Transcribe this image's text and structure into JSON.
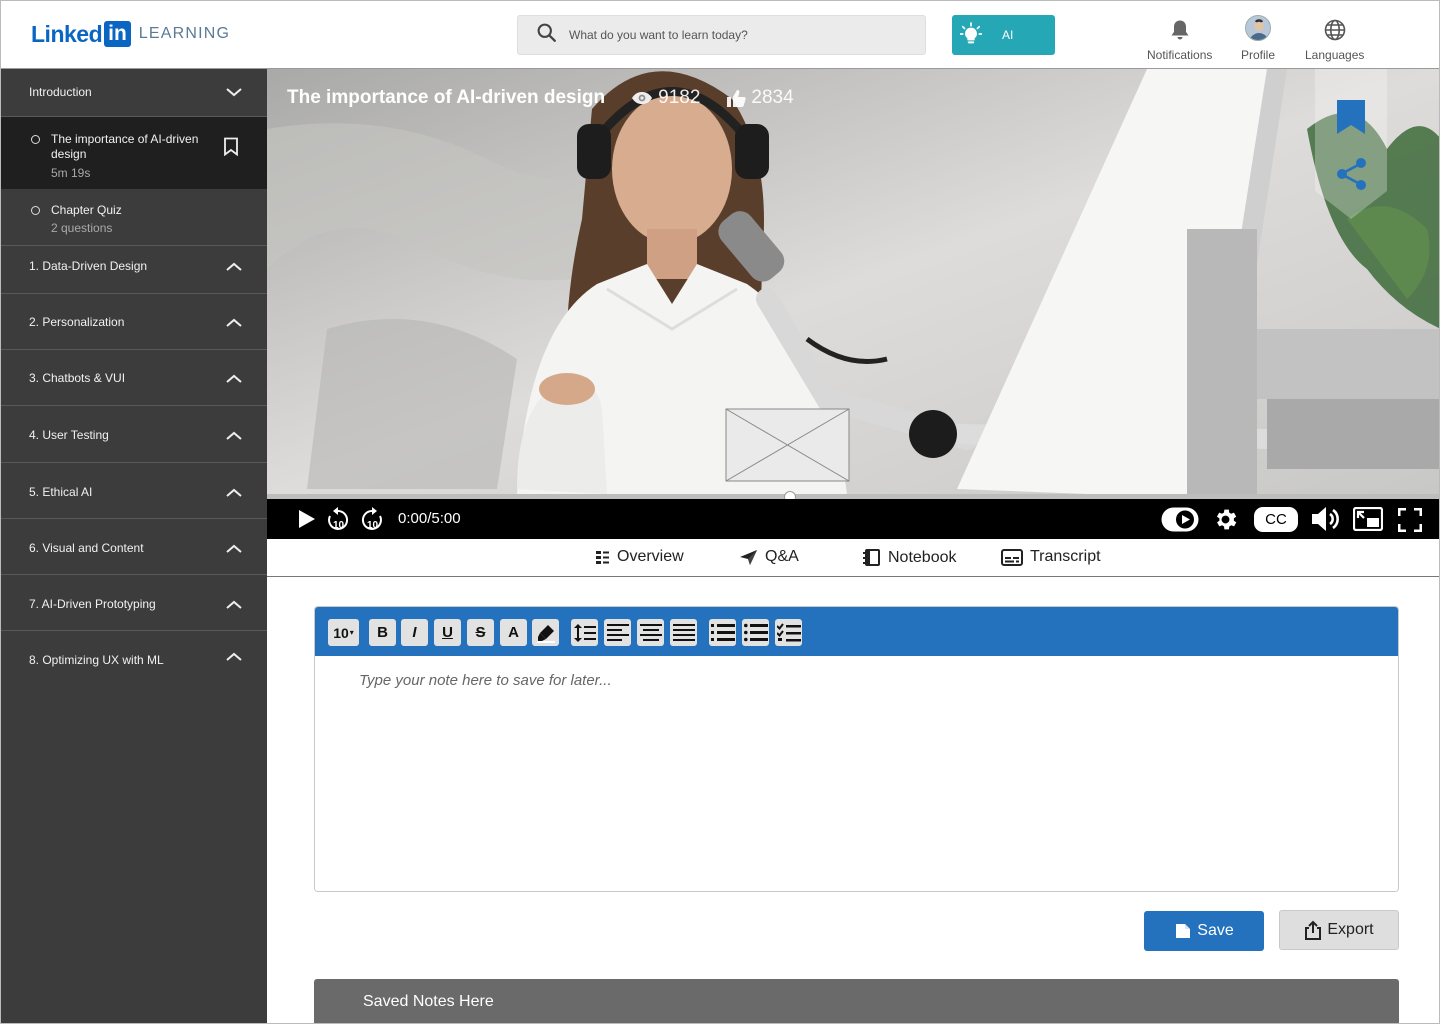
{
  "header": {
    "logo_linked": "Linked",
    "logo_in": "in",
    "logo_product": "LEARNING",
    "search_placeholder": "What do you want to learn today?",
    "ai_label": "AI",
    "nav": [
      {
        "label": "Notifications",
        "icon": "bell-icon"
      },
      {
        "label": "Profile",
        "icon": "avatar"
      },
      {
        "label": "Languages",
        "icon": "globe-icon"
      }
    ]
  },
  "sidebar": {
    "intro": {
      "label": "Introduction",
      "state": "expanded"
    },
    "lessons": [
      {
        "title": "The importance of AI-driven design",
        "meta": "5m 19s",
        "active": true
      },
      {
        "title": "Chapter Quiz",
        "meta": "2 questions",
        "active": false
      }
    ],
    "chapters": [
      "1. Data-Driven Design",
      "2. Personalization",
      "3. Chatbots & VUI",
      "4. User Testing",
      "5. Ethical AI",
      "6. Visual and Content",
      "7. AI-Driven Prototyping",
      "8. Optimizing UX with ML"
    ]
  },
  "video": {
    "title": "The importance of AI-driven design",
    "views": "9182",
    "likes": "2834",
    "time": "0:00/5:00",
    "cc_label": "CC",
    "progress": 0.0
  },
  "tabs": [
    {
      "label": "Overview",
      "icon": "list-icon"
    },
    {
      "label": "Q&A",
      "icon": "send-icon"
    },
    {
      "label": "Notebook",
      "icon": "notebook-icon"
    },
    {
      "label": "Transcript",
      "icon": "transcript-icon"
    }
  ],
  "editor": {
    "font_size": "10",
    "bold": "B",
    "italic": "I",
    "underline": "U",
    "strike": "S",
    "font_color": "A",
    "placeholder": "Type your note here to save for later..."
  },
  "actions": {
    "save": "Save",
    "export": "Export"
  },
  "saved_notes": {
    "label": "Saved Notes Here"
  },
  "colors": {
    "brand": "#0a66c2",
    "accent": "#2472bd",
    "ai": "#26a7b5",
    "sidebar": "#3c3c3c"
  }
}
